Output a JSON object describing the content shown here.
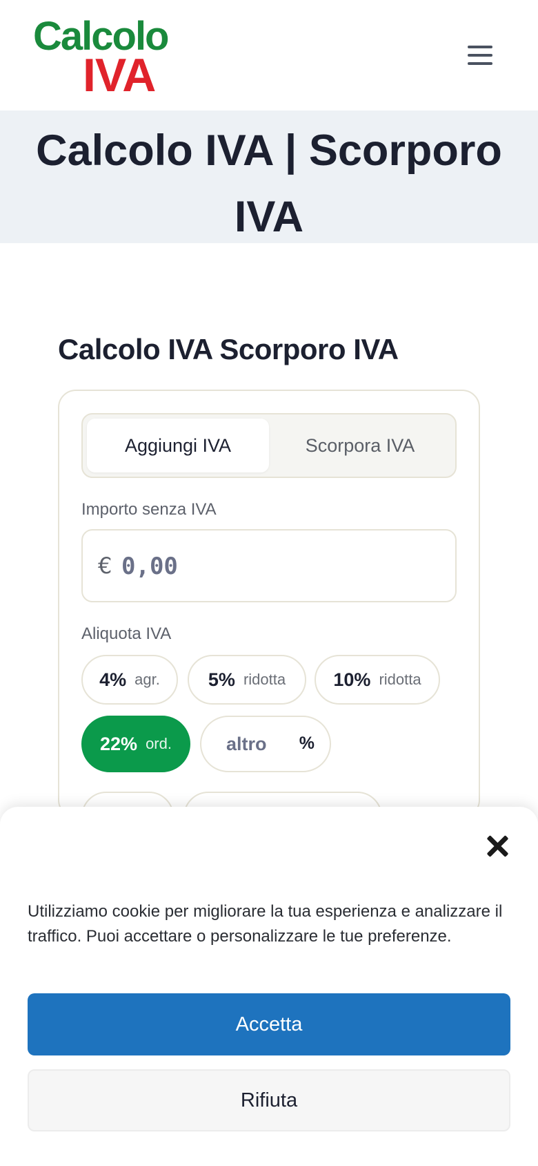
{
  "header": {
    "logo_top": "Calcolo",
    "logo_bottom": "IVA",
    "menu_icon": "hamburger-menu-icon"
  },
  "page": {
    "title": "Calcolo IVA | Scorporo IVA"
  },
  "calculator": {
    "heading": "Calcolo IVA Scorporo IVA",
    "tabs": [
      {
        "label": "Aggiungi IVA",
        "active": true
      },
      {
        "label": "Scorpora IVA",
        "active": false
      }
    ],
    "amount": {
      "label": "Importo senza IVA",
      "currency": "€",
      "value": "",
      "placeholder": "0,00"
    },
    "rate": {
      "label": "Aliquota IVA",
      "options": [
        {
          "rate": "4%",
          "desc": "agr.",
          "selected": false
        },
        {
          "rate": "5%",
          "desc": "ridotta",
          "selected": false
        },
        {
          "rate": "10%",
          "desc": "ridotta",
          "selected": false
        },
        {
          "rate": "22%",
          "desc": "ord.",
          "selected": true
        }
      ],
      "other": {
        "placeholder": "altro",
        "suffix": "%"
      }
    }
  },
  "cookie_banner": {
    "text": "Utilizziamo cookie per migliorare la tua esperienza e analizzare il traffico. Puoi accettare o personalizzare le tue preferenze.",
    "accept_label": "Accetta",
    "reject_label": "Rifiuta",
    "close_icon": "close-icon"
  },
  "colors": {
    "brand_green": "#1a8a3c",
    "brand_red": "#e0232b",
    "selected_rate": "#0b9a4b",
    "accept_button": "#1e73be",
    "title_band": "#edf1f5"
  }
}
